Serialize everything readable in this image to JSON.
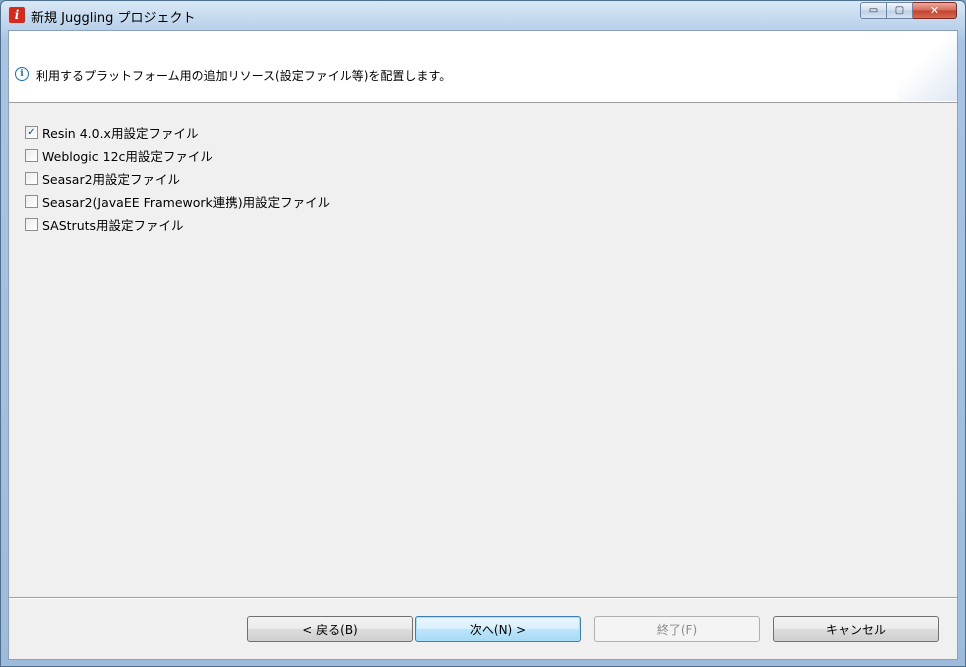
{
  "window": {
    "title": "新規 Juggling プロジェクト",
    "icon_letter": "i",
    "controls": {
      "minimize": "▭",
      "maximize": "▢",
      "close": "✕"
    }
  },
  "banner": {
    "info_glyph": "i",
    "message": "利用するプラットフォーム用の追加リソース(設定ファイル等)を配置します。"
  },
  "options": [
    {
      "label": "Resin 4.0.x用設定ファイル",
      "checked": true
    },
    {
      "label": "Weblogic 12c用設定ファイル",
      "checked": false
    },
    {
      "label": "Seasar2用設定ファイル",
      "checked": false
    },
    {
      "label": "Seasar2(JavaEE Framework連携)用設定ファイル",
      "checked": false
    },
    {
      "label": "SAStruts用設定ファイル",
      "checked": false
    }
  ],
  "buttons": {
    "back": "< 戻る(B)",
    "next": "次へ(N) >",
    "finish": "終了(F)",
    "cancel": "キャンセル"
  },
  "colors": {
    "accent": "#1b6fb6",
    "check": "#21429d",
    "close_button": "#c4412f"
  }
}
